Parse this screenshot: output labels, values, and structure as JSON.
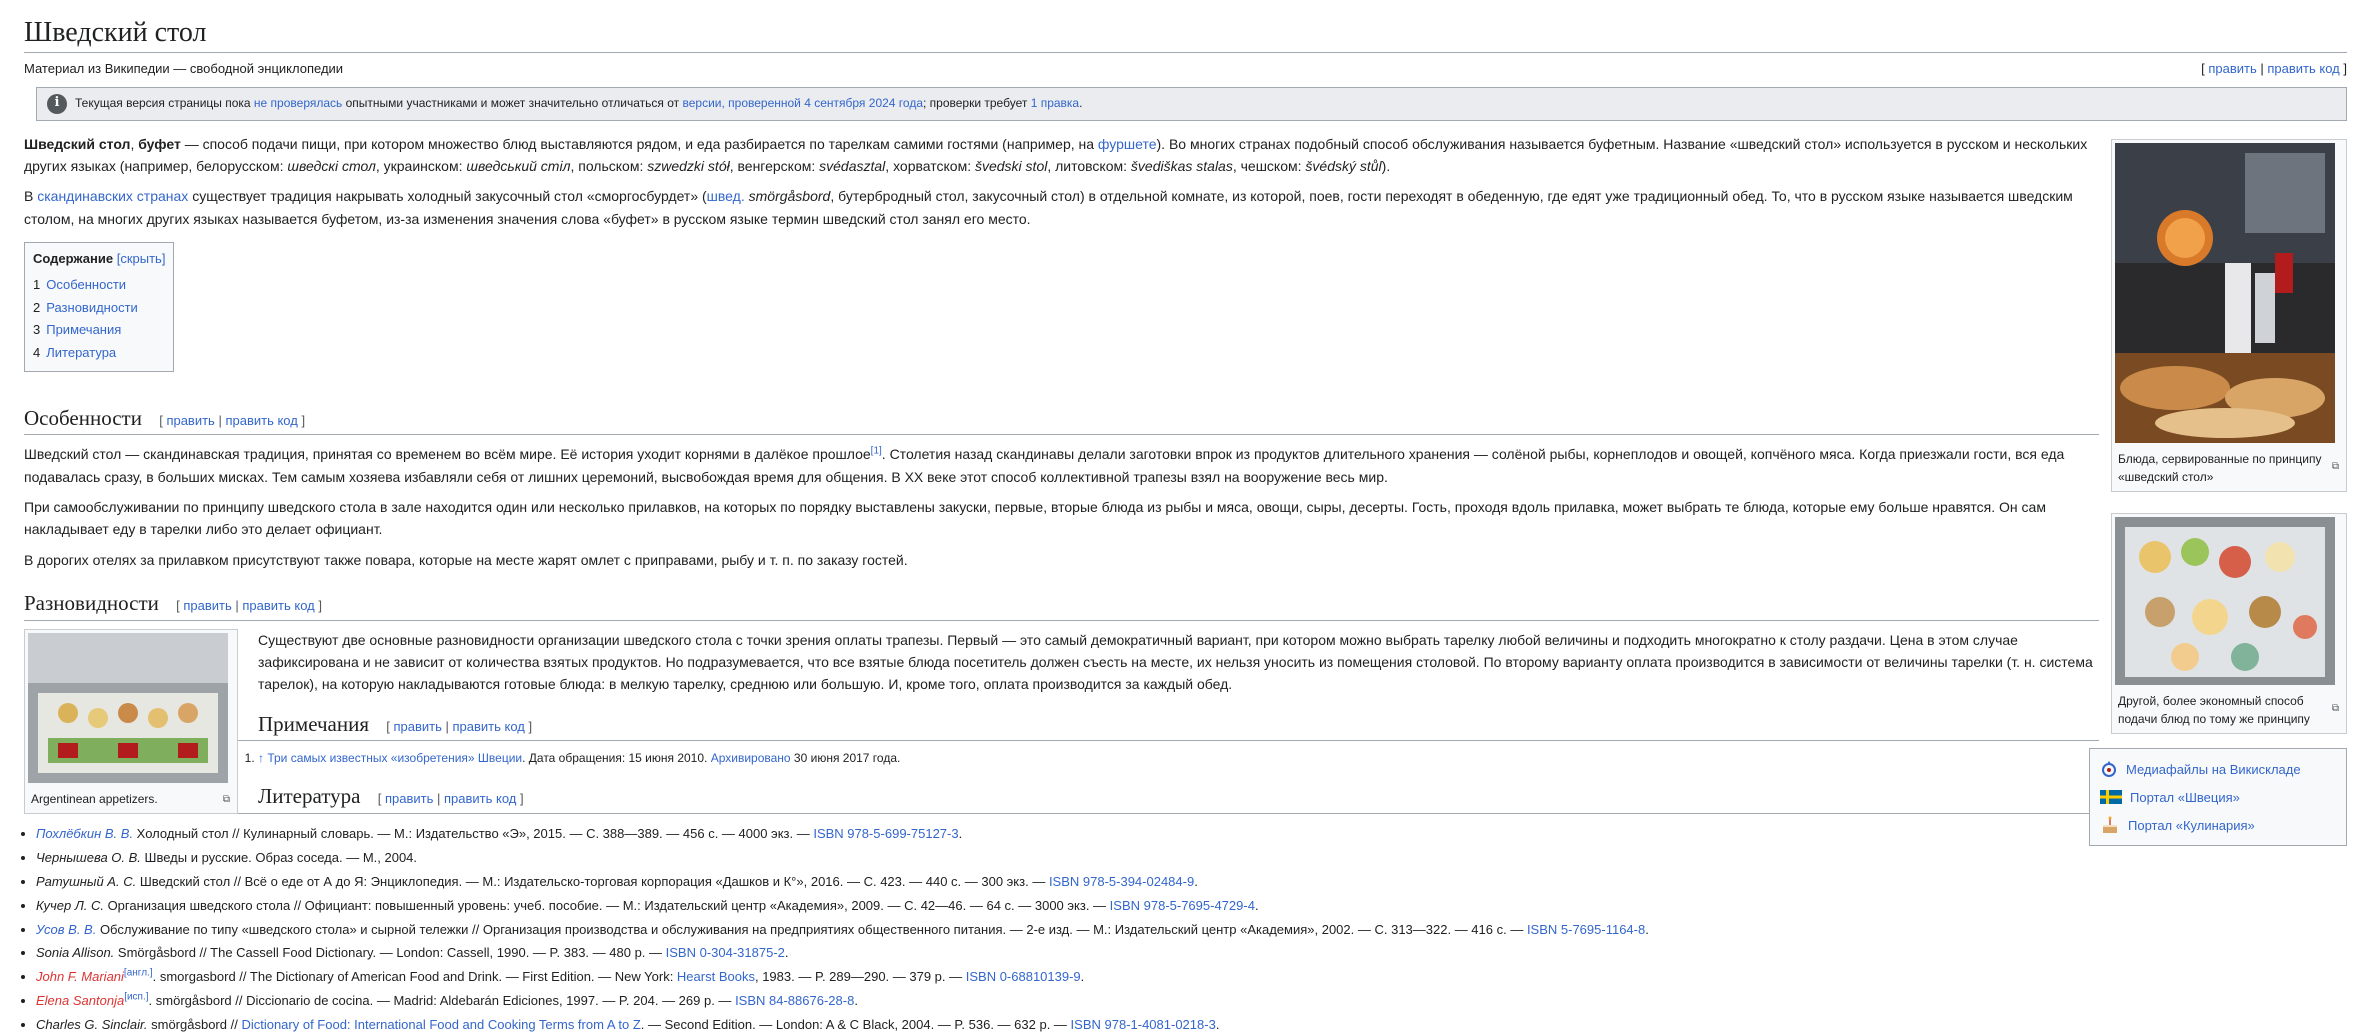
{
  "title": "Шведский стол",
  "subtitle": "Материал из Википедии — свободной энциклопедии",
  "edit": {
    "open": "[ ",
    "edit": "править",
    "sep": " | ",
    "edit_code": "править код",
    "close": " ]"
  },
  "notice": {
    "t1": "Текущая версия страницы пока ",
    "l1": "не проверялась",
    "t2": " опытными участниками и может значительно отличаться от ",
    "l2": "версии, проверенной 4 сентября 2024 года",
    "t3": "; проверки требует ",
    "l3": "1 правка",
    "t4": "."
  },
  "intro": {
    "p1_bold": "Шведский стол",
    "p1_a": ", ",
    "p1_bold2": "буфет",
    "p1_b": " — способ подачи пищи, при котором множество блюд выставляются рядом, и еда разбирается по тарелкам самими гостями (например, на ",
    "p1_link": "фуршете",
    "p1_c": "). Во многих странах подобный способ обслуживания называется буфетным. Название «шведский стол» используется в русском и нескольких других языках (например, белорусском: ",
    "p1_i1": "шведскі стол",
    "p1_d": ", украинском: ",
    "p1_i2": "шведський стіл",
    "p1_e": ", польском: ",
    "p1_i3": "szwedzki stół",
    "p1_f": ", венгерском: ",
    "p1_i4": "svédasztal",
    "p1_g": ", хорватском: ",
    "p1_i5": "švedski stol",
    "p1_h": ", литовском: ",
    "p1_i6": "švediškas stalas",
    "p1_j": ", чешском: ",
    "p1_i7": "švédský stůl",
    "p1_k": ").",
    "p2_a": "В ",
    "p2_link": "скандинавских странах",
    "p2_b": " существует традиция накрывать холодный закусочный стол «сморгосбурдет» (",
    "p2_link2": "швед.",
    "p2_i": " smörgåsbord",
    "p2_c": ", бутербродный стол, закусочный стол) в отдельной комнате, из которой, поев, гости переходят в обеденную, где едят уже традиционный обед. То, что в русском языке называется шведским столом, на многих других языках называется буфетом, из-за изменения значения слова «буфет» в русском языке термин шведский стол занял его место."
  },
  "toc": {
    "title": "Содержание",
    "toggle": "[скрыть]",
    "items": [
      {
        "num": "1",
        "label": "Особенности"
      },
      {
        "num": "2",
        "label": "Разновидности"
      },
      {
        "num": "3",
        "label": "Примечания"
      },
      {
        "num": "4",
        "label": "Литература"
      }
    ]
  },
  "osob": {
    "heading": "Особенности",
    "p1_a": "Шведский стол — скандинавская традиция, принятая со временем во всём мире. Её история уходит корнями в далёкое прошлое",
    "p1_ref": "[1]",
    "p1_b": ". Столетия назад скандинавы делали заготовки впрок из продуктов длительного хранения — солёной рыбы, корнеплодов и овощей, копчёного мяса. Когда приезжали гости, вся еда подавалась сразу, в больших мисках. Тем самым хозяева избавляли себя от лишних церемоний, высвобождая время для общения. В XX веке этот способ коллективной трапезы взял на вооружение весь мир.",
    "p2": "При самообслуживании по принципу шведского стола в зале находится один или несколько прилавков, на которых по порядку выставлены закуски, первые, вторые блюда из рыбы и мяса, овощи, сыры, десерты. Гость, проходя вдоль прилавка, может выбрать те блюда, которые ему больше нравятся. Он сам накладывает еду в тарелки либо это делает официант.",
    "p3": "В дорогих отелях за прилавком присутствуют также повара, которые на месте жарят омлет с приправами, рыбу и т. п. по заказу гостей."
  },
  "razn": {
    "heading": "Разновидности",
    "p": "Существуют две основные разновидности организации шведского стола с точки зрения оплаты трапезы. Первый — это самый демократичный вариант, при котором можно выбрать тарелку любой величины и подходить многократно к столу раздачи. Цена в этом случае зафиксирована и не зависит от количества взятых продуктов. Но подразумевается, что все взятые блюда посетитель должен съесть на месте, их нельзя уносить из помещения столовой. По второму варианту оплата производится в зависимости от величины тарелки (т. н. система тарелок), на которую накладываются готовые блюда: в мелкую тарелку, среднюю или большую. И, кроме того, оплата производится за каждый обед.",
    "caption": "Argentinean appetizers."
  },
  "notes": {
    "heading": "Примечания",
    "n1_arrow": "↑ ",
    "n1_link": "Три самых известных «изобретения» Швеции",
    "n1_a": ". Дата обращения: 15 июня 2010. ",
    "n1_link2": "Архивировано",
    "n1_b": " 30 июня 2017 года."
  },
  "lit": {
    "heading": "Литература",
    "items": [
      {
        "author": "Похлёбкин В. В.",
        "author_style": "link",
        "text": " Холодный стол // Кулинарный словарь. — М.: Издательство «Э», 2015. — С. 388—389. — 456 с. — 4000 экз. — ",
        "isbn": "ISBN 978-5-699-75127-3",
        "tail": "."
      },
      {
        "author": "Чернышева О. В.",
        "author_style": "plain",
        "text": " Шведы и русские. Образ соседа. — М., 2004.",
        "isbn": "",
        "tail": ""
      },
      {
        "author": "Ратушный А. С.",
        "author_style": "plain",
        "text": " Шведский стол // Всё о еде от А до Я: Энциклопедия. — М.: Издательско-торговая корпорация «Дашков и К°», 2016. — С. 423. — 440 с. — 300 экз. — ",
        "isbn": "ISBN 978-5-394-02484-9",
        "tail": "."
      },
      {
        "author": "Кучер Л. С.",
        "author_style": "plain",
        "text": " Организация шведского стола // Официант: повышенный уровень: учеб. пособие. — М.: Издательский центр «Академия», 2009. — С. 42—46. — 64 с. — 3000 экз. — ",
        "isbn": "ISBN 978-5-7695-4729-4",
        "tail": "."
      },
      {
        "author": "Усов В. В.",
        "author_style": "link",
        "text": " Обслуживание по типу «шведского стола» и сырной тележки // Организация производства и обслуживания на предприятиях общественного питания. — 2-е изд. — М.: Издательский центр «Академия», 2002. — С. 313—322. — 416 с. — ",
        "isbn": "ISBN 5-7695-1164-8",
        "tail": "."
      },
      {
        "author": "Sonia Allison.",
        "author_style": "plain",
        "text": " Smörgåsbord // The Cassell Food Dictionary. — London: Cassell, 1990. — P. 383. — 480 p. — ",
        "isbn": "ISBN 0-304-31875-2",
        "tail": "."
      },
      {
        "author": "John F. Mariani",
        "author_style": "red",
        "sup": "[англ.]",
        "text": ". smorgasbord // The Dictionary of American Food and Drink. — First Edition. — New York: ",
        "pub": "Hearst Books",
        "text2": ", 1983. — P. 289—290. — 379 p. — ",
        "isbn": "ISBN 0-68810139-9",
        "tail": "."
      },
      {
        "author": "Elena Santonja",
        "author_style": "red",
        "sup": "[исп.]",
        "text": ". smörgåsbord // Diccionario de cocina. — Madrid: Aldebarán Ediciones, 1997. — P. 204. — 269 p. — ",
        "isbn": "ISBN 84-88676-28-8",
        "tail": "."
      },
      {
        "author": "Charles G. Sinclair.",
        "author_style": "plain",
        "text": " smörgåsbord // ",
        "pub": "Dictionary of Food: International Food and Cooking Terms from A to Z",
        "text2": ". — Second Edition. — London: A & C Black, 2004. — P. 536. — 632 p. — ",
        "isbn": "ISBN 978-1-4081-0218-3",
        "tail": "."
      }
    ]
  },
  "thumbs": {
    "t1_caption": "Блюда, сервированные по принципу «шведский стол»",
    "t2_caption": "Другой, более экономный способ подачи блюд по тому же принципу"
  },
  "portals": [
    {
      "icon": "commons-icon",
      "label": "Медиафайлы на Викискладе"
    },
    {
      "icon": "sweden-flag-icon",
      "label": "Портал «Швеция»"
    },
    {
      "icon": "cake-icon",
      "label": "Портал «Кулинария»"
    }
  ]
}
